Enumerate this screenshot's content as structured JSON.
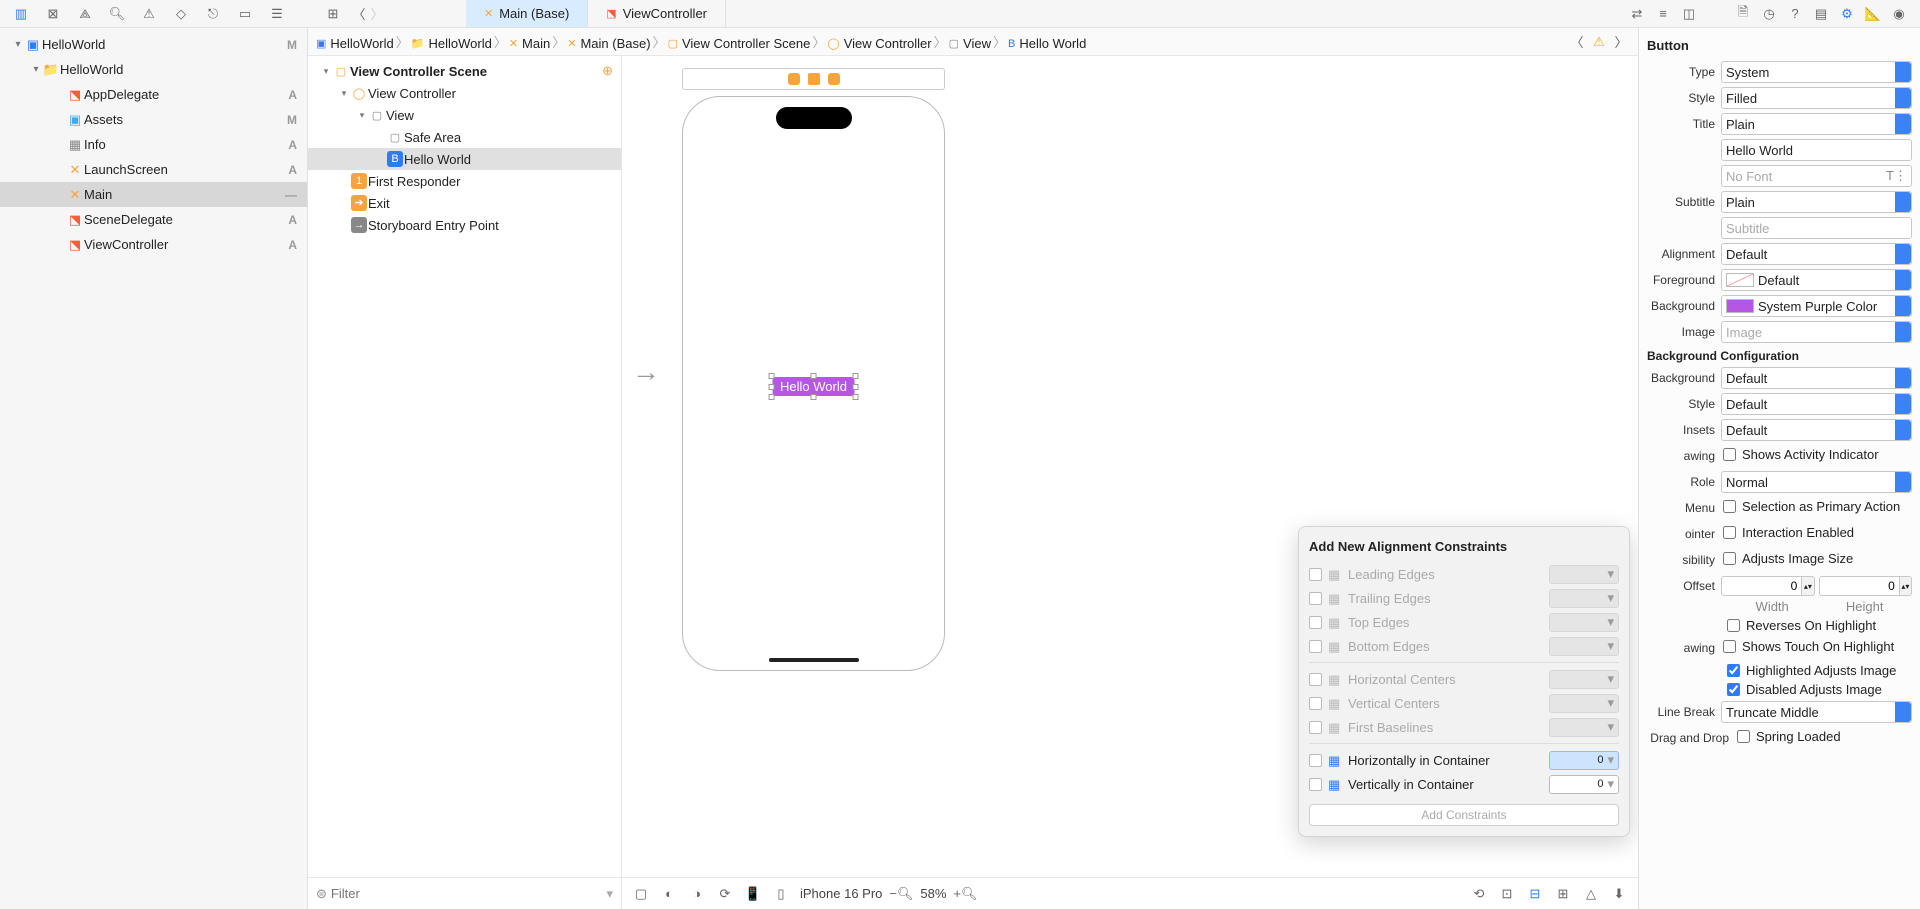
{
  "tabs": [
    {
      "label": "Main (Base)",
      "active": true,
      "icon_color": "#f7a43d"
    },
    {
      "label": "ViewController",
      "active": false,
      "icon_color": "#f35f3b"
    }
  ],
  "navigator": {
    "project_name": "HelloWorld",
    "group_name": "HelloWorld",
    "project_status": "M",
    "items": [
      {
        "label": "AppDelegate",
        "status": "A",
        "icon": "swift",
        "indent": 2
      },
      {
        "label": "Assets",
        "status": "M",
        "icon": "assets",
        "indent": 2
      },
      {
        "label": "Info",
        "status": "A",
        "icon": "plist",
        "indent": 2
      },
      {
        "label": "LaunchScreen",
        "status": "A",
        "icon": "storyboard",
        "indent": 2
      },
      {
        "label": "Main",
        "status": "—",
        "icon": "storyboard",
        "indent": 2,
        "selected": true
      },
      {
        "label": "SceneDelegate",
        "status": "A",
        "icon": "swift",
        "indent": 2
      },
      {
        "label": "ViewController",
        "status": "A",
        "icon": "swift",
        "indent": 2
      }
    ]
  },
  "jumpbar": [
    {
      "icon": "app",
      "label": "HelloWorld"
    },
    {
      "icon": "folder",
      "label": "HelloWorld"
    },
    {
      "icon": "sb",
      "label": "Main"
    },
    {
      "icon": "sb",
      "label": "Main (Base)"
    },
    {
      "icon": "scene",
      "label": "View Controller Scene"
    },
    {
      "icon": "vc",
      "label": "View Controller"
    },
    {
      "icon": "view",
      "label": "View"
    },
    {
      "icon": "btn",
      "label": "Hello World"
    }
  ],
  "outline": {
    "items": [
      {
        "label": "View Controller Scene",
        "indent": 0,
        "icon": "scene",
        "disclosure": true
      },
      {
        "label": "View Controller",
        "indent": 1,
        "icon": "vc",
        "disclosure": true
      },
      {
        "label": "View",
        "indent": 2,
        "icon": "view",
        "disclosure": true
      },
      {
        "label": "Safe Area",
        "indent": 3,
        "icon": "safe",
        "disclosure": false
      },
      {
        "label": "Hello World",
        "indent": 3,
        "icon": "btn",
        "disclosure": false,
        "selected": true
      },
      {
        "label": "First Responder",
        "indent": 1,
        "icon": "first",
        "disclosure": false
      },
      {
        "label": "Exit",
        "indent": 1,
        "icon": "exit",
        "disclosure": false
      },
      {
        "label": "Storyboard Entry Point",
        "indent": 1,
        "icon": "entry",
        "disclosure": false
      }
    ],
    "filter_placeholder": "Filter"
  },
  "canvas": {
    "button_text": "Hello World",
    "device_label": "iPhone 16 Pro",
    "zoom": "58%"
  },
  "popover": {
    "title": "Add New Alignment Constraints",
    "rows_top": [
      "Leading Edges",
      "Trailing Edges",
      "Top Edges",
      "Bottom Edges"
    ],
    "rows_mid": [
      "Horizontal Centers",
      "Vertical Centers",
      "First Baselines"
    ],
    "rows_container": [
      {
        "label": "Horizontally in Container",
        "value": "0",
        "highlighted": true
      },
      {
        "label": "Vertically in Container",
        "value": "0",
        "highlighted": false
      }
    ],
    "add_button": "Add Constraints"
  },
  "inspector": {
    "section": "Button",
    "type": "System",
    "style": "Filled",
    "title_mode": "Plain",
    "title_text": "Hello World",
    "font": "No Font",
    "subtitle_mode": "Plain",
    "subtitle_placeholder": "Subtitle",
    "alignment": "Default",
    "foreground": "Default",
    "background_color_name": "System Purple Color",
    "background_color_hex": "#b556e5",
    "image_placeholder": "Image",
    "bg_config_header": "Background Configuration",
    "bg_config_background": "Default",
    "bg_config_style": "Default",
    "bg_config_insets": "Default",
    "shows_activity": "Shows Activity Indicator",
    "role": "Normal",
    "menu": "Selection as Primary Action",
    "pointer": "Interaction Enabled",
    "accessibility": "Adjusts Image Size",
    "offset_width": "0",
    "offset_height": "0",
    "width_label": "Width",
    "height_label": "Height",
    "reverses": "Reverses On Highlight",
    "shows_touch": "Shows Touch On Highlight",
    "highlighted_adjusts": "Highlighted Adjusts Image",
    "disabled_adjusts": "Disabled Adjusts Image",
    "line_break": "Truncate Middle",
    "spring_loaded": "Spring Loaded",
    "labels": {
      "type": "Type",
      "style": "Style",
      "title": "Title",
      "subtitle": "Subtitle",
      "alignment": "Alignment",
      "foreground": "Foreground",
      "background": "Background",
      "image": "Image",
      "bg_config_background": "Background",
      "bg_style": "Style",
      "insets": "Insets",
      "awing": "awing",
      "role": "Role",
      "menu": "Menu",
      "ointer": "ointer",
      "sibility": "sibility",
      "offset": "Offset",
      "drawing": "awing",
      "line_break": "Line Break",
      "drag_drop": "Drag and Drop"
    }
  }
}
